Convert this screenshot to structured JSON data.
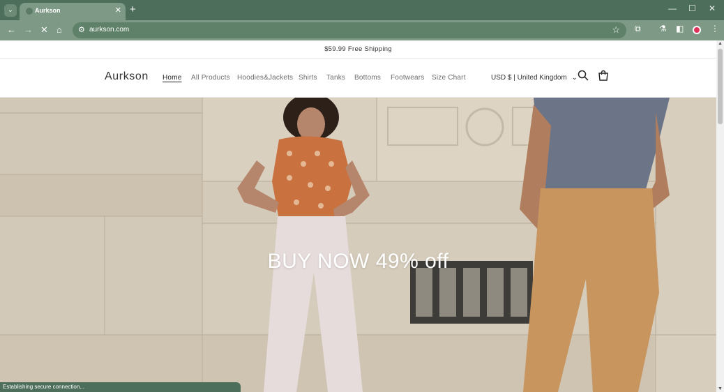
{
  "browser": {
    "tab_title": "Aurkson",
    "url": "aurkson.com",
    "status_text": "Establishing secure connection..."
  },
  "site": {
    "announcement": "$59.99 Free Shipping",
    "logo": "Aurkson",
    "nav": [
      {
        "label": "Home",
        "active": true
      },
      {
        "label": "All Products"
      },
      {
        "label": "Hoodies&Jackets"
      },
      {
        "label": "Shirts"
      },
      {
        "label": "Tanks"
      },
      {
        "label": "Bottoms"
      },
      {
        "label": "Footwears"
      },
      {
        "label": "Size Chart"
      }
    ],
    "currency": "USD $ | United Kingdom"
  },
  "hero": {
    "headline": "BUY NOW 49% off"
  },
  "colors": {
    "chrome": "#4d6e5a",
    "toolbar": "#7e9a86"
  },
  "icons": [
    "tab-search-icon",
    "close-icon",
    "plus-icon",
    "minimize-icon",
    "maximize-icon",
    "back-icon",
    "forward-icon",
    "stop-icon",
    "home-icon",
    "site-info-icon",
    "star-icon",
    "extensions-icon",
    "labs-icon",
    "side-panel-icon",
    "profile-icon",
    "menu-icon",
    "search-icon",
    "cart-icon"
  ]
}
